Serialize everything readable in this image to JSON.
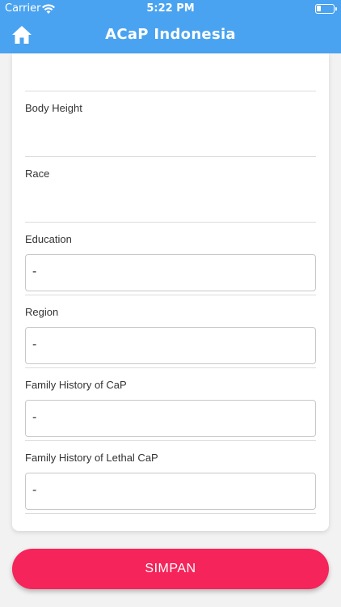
{
  "status_bar": {
    "carrier": "Carrier",
    "time": "5:22 PM"
  },
  "app_bar": {
    "title": "ACaP Indonesia"
  },
  "form": {
    "fields": [
      {
        "label": "Body Height",
        "value": ""
      },
      {
        "label": "Race",
        "value": ""
      },
      {
        "label": "Education",
        "value": "-"
      },
      {
        "label": "Region",
        "value": "-"
      },
      {
        "label": "Family History of CaP",
        "value": "-"
      },
      {
        "label": "Family History of Lethal CaP",
        "value": "-"
      }
    ]
  },
  "save_button": {
    "label": "SIMPAN"
  },
  "colors": {
    "primary": "#4aa3f0",
    "accent": "#f5245a"
  }
}
